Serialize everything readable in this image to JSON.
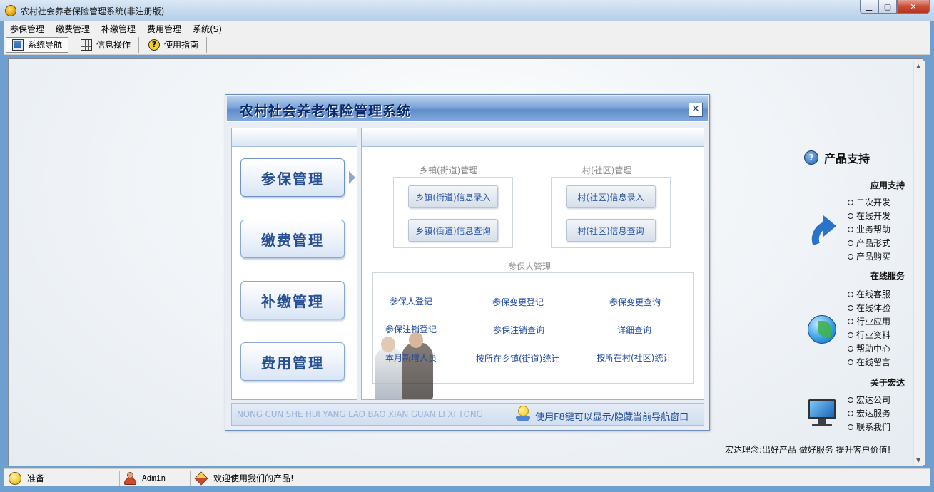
{
  "window": {
    "title": "农村社会养老保险管理系统(非注册版)",
    "min": "0",
    "max": "1",
    "close": "r"
  },
  "menu": [
    "参保管理",
    "缴费管理",
    "补缴管理",
    "费用管理",
    "系统(S)"
  ],
  "toolbar": {
    "nav_label": "系统导航",
    "info_label": "信息操作",
    "guide_label": "使用指南"
  },
  "dialog": {
    "title": "农村社会养老保险管理系统",
    "close": "✕",
    "nav_buttons": [
      "参保管理",
      "缴费管理",
      "补缴管理",
      "费用管理"
    ],
    "active_nav": "参保管理",
    "town_group": {
      "title": "乡镇(街道)管理",
      "buttons": [
        "乡镇(街道)信息录入",
        "乡镇(街道)信息查询"
      ]
    },
    "village_group": {
      "title": "村(社区)管理",
      "buttons": [
        "村(社区)信息录入",
        "村(社区)信息查询"
      ]
    },
    "insured_group": {
      "title": "参保人管理",
      "links": [
        [
          "参保人登记",
          "参保变更登记",
          "参保变更查询"
        ],
        [
          "参保注销登记",
          "参保注销查询",
          "详细查询"
        ],
        [
          "本月新增人员",
          "按所在乡镇(街道)统计",
          "按所在村(社区)统计"
        ]
      ]
    },
    "footer_pinyin": "NONG CUN SHE HUI YANG LAO BAO XIAN GUAN LI XI TONG",
    "footer_tip": "使用F8键可以显示/隐藏当前导航窗口"
  },
  "support": {
    "title": "产品支持",
    "sections": [
      {
        "title": "应用支持",
        "items": [
          "二次开发",
          "在线开发",
          "业务帮助",
          "产品形式",
          "产品购买"
        ]
      },
      {
        "title": "在线服务",
        "items": [
          "在线客服",
          "在线体验",
          "行业应用",
          "行业资料",
          "帮助中心",
          "在线留言"
        ]
      },
      {
        "title": "关于宏达",
        "items": [
          "宏达公司",
          "宏达服务",
          "联系我们"
        ]
      }
    ],
    "motto": "宏达理念:出好产品 做好服务 提升客户价值!"
  },
  "status": {
    "ready": "准备",
    "user": "Admin",
    "welcome": "欢迎使用我们的产品!"
  }
}
